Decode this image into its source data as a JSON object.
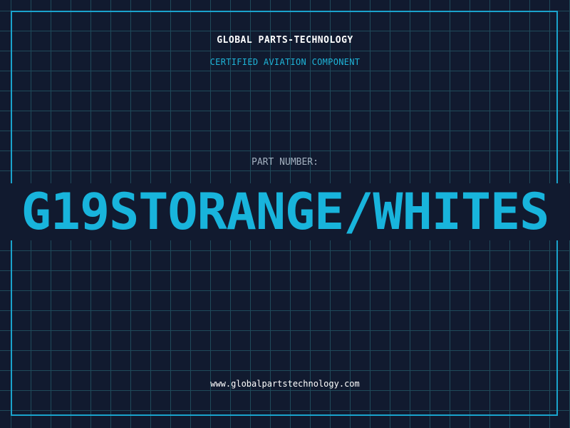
{
  "header": {
    "company": "GLOBAL PARTS-TECHNOLOGY",
    "tagline": "CERTIFIED AVIATION COMPONENT"
  },
  "part": {
    "label": "PART NUMBER:",
    "number": "G19STORANGE/WHITES"
  },
  "footer": {
    "url": "www.globalpartstechnology.com"
  },
  "colors": {
    "background": "#111a2f",
    "grid": "#1f4a5a",
    "accent": "#18b4dc",
    "label": "#a3b0bf",
    "text": "#ffffff"
  }
}
